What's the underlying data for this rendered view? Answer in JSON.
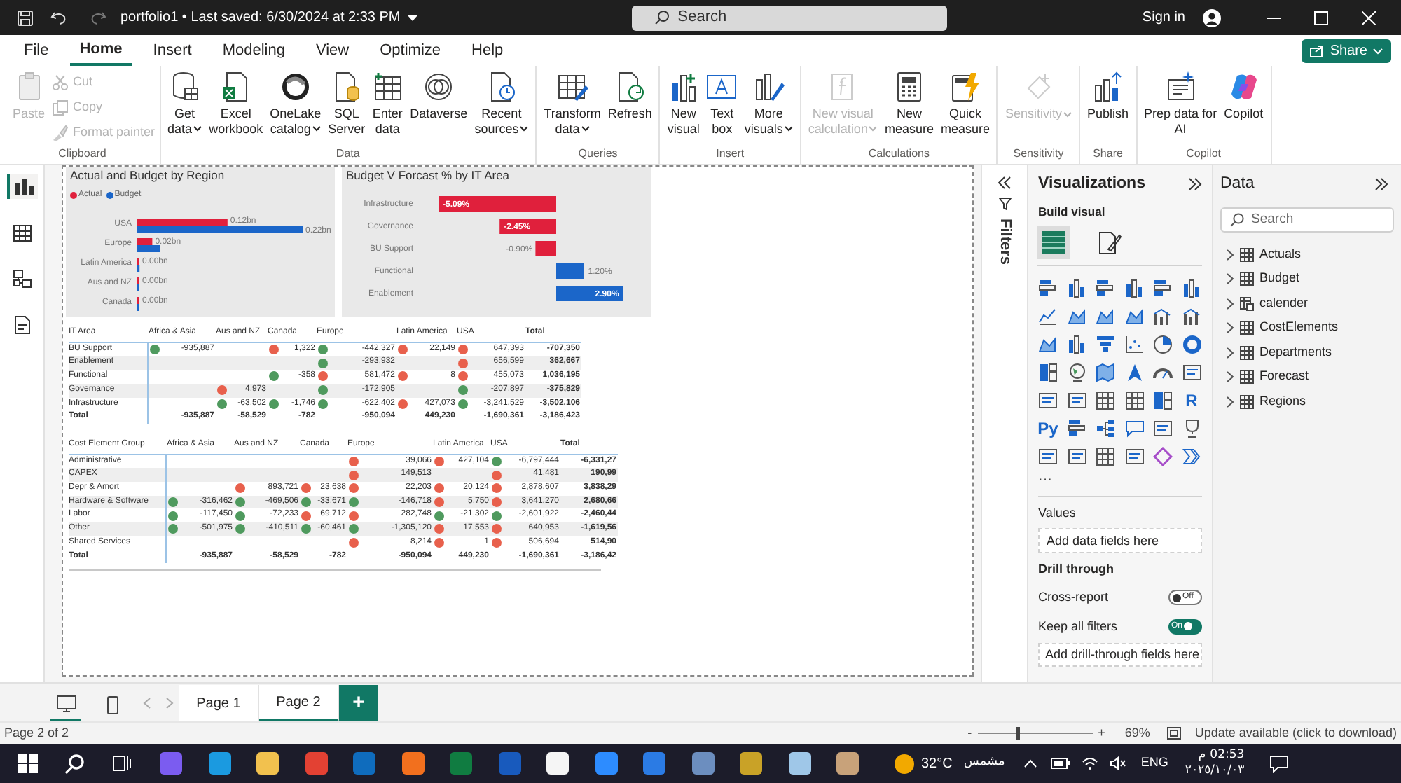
{
  "title_bar": {
    "title": "portfolio1 • Last saved: 6/30/2024 at 2:33 PM",
    "search_placeholder": "Search",
    "sign_in": "Sign in"
  },
  "menu_tabs": [
    {
      "label": "File",
      "selected": false
    },
    {
      "label": "Home",
      "selected": true
    },
    {
      "label": "Insert",
      "selected": false
    },
    {
      "label": "Modeling",
      "selected": false
    },
    {
      "label": "View",
      "selected": false
    },
    {
      "label": "Optimize",
      "selected": false
    },
    {
      "label": "Help",
      "selected": false
    }
  ],
  "share_button": "Share",
  "ribbon": [
    {
      "label": "Clipboard",
      "buttons": [
        {
          "lines": [
            "Paste"
          ],
          "kind": "large",
          "disabled": true,
          "dropdown": false
        },
        {
          "lines": [
            "Cut"
          ],
          "kind": "small",
          "disabled": true,
          "dropdown": false
        },
        {
          "lines": [
            "Copy"
          ],
          "kind": "small",
          "disabled": true,
          "dropdown": false
        },
        {
          "lines": [
            "Format painter"
          ],
          "kind": "small",
          "disabled": true,
          "dropdown": false
        }
      ]
    },
    {
      "label": "Data",
      "buttons": [
        {
          "lines": [
            "Get",
            "data"
          ],
          "kind": "large",
          "disabled": false,
          "dropdown": true
        },
        {
          "lines": [
            "Excel",
            "workbook"
          ],
          "kind": "large",
          "disabled": false,
          "dropdown": false
        },
        {
          "lines": [
            "OneLake",
            "catalog"
          ],
          "kind": "large",
          "disabled": false,
          "dropdown": true
        },
        {
          "lines": [
            "SQL",
            "Server"
          ],
          "kind": "large",
          "disabled": false,
          "dropdown": false
        },
        {
          "lines": [
            "Enter",
            "data"
          ],
          "kind": "large",
          "disabled": false,
          "dropdown": false
        },
        {
          "lines": [
            "Dataverse"
          ],
          "kind": "large",
          "disabled": false,
          "dropdown": false
        },
        {
          "lines": [
            "Recent",
            "sources"
          ],
          "kind": "large",
          "disabled": false,
          "dropdown": true
        }
      ]
    },
    {
      "label": "Queries",
      "buttons": [
        {
          "lines": [
            "Transform",
            "data"
          ],
          "kind": "large",
          "disabled": false,
          "dropdown": true
        },
        {
          "lines": [
            "Refresh"
          ],
          "kind": "large",
          "disabled": false,
          "dropdown": false
        }
      ]
    },
    {
      "label": "Insert",
      "buttons": [
        {
          "lines": [
            "New",
            "visual"
          ],
          "kind": "large",
          "disabled": false,
          "dropdown": false
        },
        {
          "lines": [
            "Text",
            "box"
          ],
          "kind": "large",
          "disabled": false,
          "dropdown": false
        },
        {
          "lines": [
            "More",
            "visuals"
          ],
          "kind": "large",
          "disabled": false,
          "dropdown": true
        }
      ]
    },
    {
      "label": "Calculations",
      "buttons": [
        {
          "lines": [
            "New visual",
            "calculation"
          ],
          "kind": "large",
          "disabled": true,
          "dropdown": true
        },
        {
          "lines": [
            "New",
            "measure"
          ],
          "kind": "large",
          "disabled": false,
          "dropdown": false
        },
        {
          "lines": [
            "Quick",
            "measure"
          ],
          "kind": "large",
          "disabled": false,
          "dropdown": false
        }
      ]
    },
    {
      "label": "Sensitivity",
      "buttons": [
        {
          "lines": [
            "Sensitivity"
          ],
          "kind": "large",
          "disabled": true,
          "dropdown": true
        }
      ]
    },
    {
      "label": "Share",
      "buttons": [
        {
          "lines": [
            "Publish"
          ],
          "kind": "large",
          "disabled": false,
          "dropdown": false
        }
      ]
    },
    {
      "label": "Copilot",
      "buttons": [
        {
          "lines": [
            "Prep data for",
            "AI"
          ],
          "kind": "large",
          "disabled": false,
          "dropdown": false
        },
        {
          "lines": [
            "Copilot"
          ],
          "kind": "large",
          "disabled": false,
          "dropdown": false
        }
      ]
    }
  ],
  "left_rail": [
    {
      "kind": "report",
      "selected": true
    },
    {
      "kind": "table",
      "selected": false
    },
    {
      "kind": "model",
      "selected": false
    },
    {
      "kind": "dax",
      "selected": false
    }
  ],
  "charts": [
    {
      "chart_data": {
        "type": "bar",
        "orientation": "horizontal",
        "title": "Actual and Budget by Region",
        "legend": "top-left",
        "categories": [
          "USA",
          "Europe",
          "Latin America",
          "Aus and NZ",
          "Canada"
        ],
        "series": [
          {
            "name": "Actual",
            "color": "#e0203c",
            "values": [
              0.12,
              0.02,
              0,
              0,
              0
            ],
            "value_labels": [
              "0.12bn",
              "0.02bn",
              "0.00bn",
              "0.00bn",
              "0.00bn"
            ]
          },
          {
            "name": "Budget",
            "color": "#1b66c9",
            "values": [
              0.22,
              0.03,
              0.003,
              0.002,
              0.001
            ],
            "value_labels": [
              "0.22bn",
              null,
              null,
              null,
              null
            ]
          }
        ]
      }
    },
    {
      "chart_data": {
        "type": "bar",
        "orientation": "horizontal",
        "stacked": true,
        "title": "Budget V Forcast % by IT Area",
        "categories": [
          "Infrastructure",
          "Governance",
          "BU Support",
          "Functional",
          "Enablement"
        ],
        "series": [
          {
            "color": "#e0203c",
            "values": [
              -5.09,
              -2.45,
              -0.9,
              null,
              null
            ],
            "value_labels": [
              "-5.09%",
              "-2.45%",
              "-0.90%",
              null,
              null
            ]
          },
          {
            "color": "#1b66c9",
            "values": [
              null,
              null,
              null,
              1.2,
              2.9
            ],
            "value_labels": [
              null,
              null,
              null,
              "1.20%",
              "2.90%"
            ]
          }
        ]
      }
    }
  ],
  "matrices": [
    {
      "row_header_title": "IT Area",
      "columns": [
        "Africa & Asia",
        "Aus and NZ",
        "Canada",
        "Europe",
        "Latin America",
        "USA",
        "Total"
      ],
      "rows": [
        {
          "kind": "row",
          "label": "BU Support",
          "cells": [
            {
              "value": "-935,887",
              "color": "#4f9a5e"
            },
            null,
            {
              "value": "1,322",
              "color": "#e8604c"
            },
            {
              "value": "-442,327",
              "color": "#4f9a5e"
            },
            {
              "value": "22,149",
              "color": "#e8604c"
            },
            {
              "value": "647,393",
              "color": "#e8604c"
            },
            {
              "value": "-707,350"
            }
          ]
        },
        {
          "kind": "row",
          "label": "Enablement",
          "cells": [
            null,
            null,
            null,
            {
              "value": "-293,932",
              "color": "#4f9a5e"
            },
            null,
            {
              "value": "656,599",
              "color": "#e8604c"
            },
            {
              "value": "362,667"
            }
          ]
        },
        {
          "kind": "row",
          "label": "Functional",
          "cells": [
            null,
            null,
            {
              "value": "-358",
              "color": "#4f9a5e"
            },
            {
              "value": "581,472",
              "color": "#e8604c"
            },
            {
              "value": "8",
              "color": "#e8604c"
            },
            {
              "value": "455,073",
              "color": "#e8604c"
            },
            {
              "value": "1,036,195"
            }
          ]
        },
        {
          "kind": "row",
          "label": "Governance",
          "cells": [
            null,
            {
              "value": "4,973",
              "color": "#e8604c"
            },
            null,
            {
              "value": "-172,905",
              "color": "#4f9a5e"
            },
            null,
            {
              "value": "-207,897",
              "color": "#4f9a5e"
            },
            {
              "value": "-375,829"
            }
          ]
        },
        {
          "kind": "row",
          "label": "Infrastructure",
          "cells": [
            null,
            {
              "value": "-63,502",
              "color": "#4f9a5e"
            },
            {
              "value": "-1,746",
              "color": "#4f9a5e"
            },
            {
              "value": "-622,402",
              "color": "#4f9a5e"
            },
            {
              "value": "427,073",
              "color": "#e8604c"
            },
            {
              "value": "-3,241,529",
              "color": "#4f9a5e"
            },
            {
              "value": "-3,502,106"
            }
          ]
        },
        {
          "kind": "total",
          "label": "Total",
          "cells": [
            {
              "value": "-935,887"
            },
            {
              "value": "-58,529"
            },
            {
              "value": "-782"
            },
            {
              "value": "-950,094"
            },
            {
              "value": "449,230"
            },
            {
              "value": "-1,690,361"
            },
            {
              "value": "-3,186,423"
            }
          ]
        }
      ]
    },
    {
      "row_header_title": "Cost Element Group",
      "columns": [
        "Africa & Asia",
        "Aus and NZ",
        "Canada",
        "Europe",
        "Latin America",
        "USA",
        "Total"
      ],
      "rows": [
        {
          "kind": "row",
          "label": "Administrative",
          "cells": [
            null,
            null,
            null,
            {
              "value": "39,066",
              "color": "#e8604c"
            },
            {
              "value": "427,104",
              "color": "#e8604c"
            },
            {
              "value": "-6,797,444",
              "color": "#4f9a5e"
            },
            {
              "value": "-6,331,27"
            }
          ]
        },
        {
          "kind": "row",
          "label": "CAPEX",
          "cells": [
            null,
            null,
            null,
            {
              "value": "149,513",
              "color": "#e8604c"
            },
            null,
            {
              "value": "41,481",
              "color": "#e8604c"
            },
            {
              "value": "190,99"
            }
          ]
        },
        {
          "kind": "row",
          "label": "Depr & Amort",
          "cells": [
            null,
            {
              "value": "893,721",
              "color": "#e8604c"
            },
            {
              "value": "23,638",
              "color": "#e8604c"
            },
            {
              "value": "22,203",
              "color": "#e8604c"
            },
            {
              "value": "20,124",
              "color": "#e8604c"
            },
            {
              "value": "2,878,607",
              "color": "#e8604c"
            },
            {
              "value": "3,838,29"
            }
          ]
        },
        {
          "kind": "row",
          "label": "Hardware & Software",
          "cells": [
            {
              "value": "-316,462",
              "color": "#4f9a5e"
            },
            {
              "value": "-469,506",
              "color": "#4f9a5e"
            },
            {
              "value": "-33,671",
              "color": "#4f9a5e"
            },
            {
              "value": "-146,718",
              "color": "#4f9a5e"
            },
            {
              "value": "5,750",
              "color": "#e8604c"
            },
            {
              "value": "3,641,270",
              "color": "#e8604c"
            },
            {
              "value": "2,680,66"
            }
          ]
        },
        {
          "kind": "row",
          "label": "Labor",
          "cells": [
            {
              "value": "-117,450",
              "color": "#4f9a5e"
            },
            {
              "value": "-72,233",
              "color": "#4f9a5e"
            },
            {
              "value": "69,712",
              "color": "#e8604c"
            },
            {
              "value": "282,748",
              "color": "#e8604c"
            },
            {
              "value": "-21,302",
              "color": "#4f9a5e"
            },
            {
              "value": "-2,601,922",
              "color": "#4f9a5e"
            },
            {
              "value": "-2,460,44"
            }
          ]
        },
        {
          "kind": "row",
          "label": "Other",
          "cells": [
            {
              "value": "-501,975",
              "color": "#4f9a5e"
            },
            {
              "value": "-410,511",
              "color": "#4f9a5e"
            },
            {
              "value": "-60,461",
              "color": "#4f9a5e"
            },
            {
              "value": "-1,305,120",
              "color": "#4f9a5e"
            },
            {
              "value": "17,553",
              "color": "#e8604c"
            },
            {
              "value": "640,953",
              "color": "#e8604c"
            },
            {
              "value": "-1,619,56"
            }
          ]
        },
        {
          "kind": "row",
          "label": "Shared Services",
          "cells": [
            null,
            null,
            null,
            {
              "value": "8,214",
              "color": "#e8604c"
            },
            {
              "value": "1",
              "color": "#e8604c"
            },
            {
              "value": "506,694",
              "color": "#e8604c"
            },
            {
              "value": "514,90"
            }
          ]
        },
        {
          "kind": "total",
          "label": "Total",
          "cells": [
            {
              "value": "-935,887"
            },
            {
              "value": "-58,529"
            },
            {
              "value": "-782"
            },
            {
              "value": "-950,094"
            },
            {
              "value": "449,230"
            },
            {
              "value": "-1,690,361"
            },
            {
              "value": "-3,186,42"
            }
          ]
        }
      ]
    }
  ],
  "filters_pane": {
    "label": "Filters"
  },
  "visualizations": {
    "title": "Visualizations",
    "build_visual": "Build visual",
    "modes": [
      {
        "kind": "fields",
        "selected": true
      },
      {
        "kind": "format",
        "selected": false
      }
    ],
    "gallery": [
      {
        "kind": "hbars"
      },
      {
        "kind": "cols"
      },
      {
        "kind": "hbars"
      },
      {
        "kind": "cols"
      },
      {
        "kind": "hbars"
      },
      {
        "kind": "cols"
      },
      {
        "kind": "line"
      },
      {
        "kind": "area"
      },
      {
        "kind": "area"
      },
      {
        "kind": "area"
      },
      {
        "kind": "combo"
      },
      {
        "kind": "combo"
      },
      {
        "kind": "area"
      },
      {
        "kind": "cols"
      },
      {
        "kind": "funnel"
      },
      {
        "kind": "scatter"
      },
      {
        "kind": "pie"
      },
      {
        "kind": "donut"
      },
      {
        "kind": "grid"
      },
      {
        "kind": "globe"
      },
      {
        "kind": "map"
      },
      {
        "kind": "arrow"
      },
      {
        "kind": "gauge"
      },
      {
        "kind": "card"
      },
      {
        "kind": "card"
      },
      {
        "kind": "card"
      },
      {
        "kind": "table"
      },
      {
        "kind": "table"
      },
      {
        "kind": "grid"
      },
      {
        "kind": "text",
        "label": "R"
      },
      {
        "kind": "text",
        "label": "Py"
      },
      {
        "kind": "hbars"
      },
      {
        "kind": "tree"
      },
      {
        "kind": "bubble"
      },
      {
        "kind": "card"
      },
      {
        "kind": "trophy"
      },
      {
        "kind": "card"
      },
      {
        "kind": "card"
      },
      {
        "kind": "table"
      },
      {
        "kind": "card"
      },
      {
        "kind": "diamond"
      },
      {
        "kind": "chevron"
      }
    ],
    "more": "···",
    "values_label": "Values",
    "values_placeholder": "Add data fields here",
    "drill_through": "Drill through",
    "toggles": [
      {
        "label": "Cross-report",
        "on": false,
        "text": "Off"
      },
      {
        "label": "Keep all filters",
        "on": true,
        "text": "On"
      }
    ],
    "drill_placeholder": "Add drill-through fields here"
  },
  "data_pane": {
    "title": "Data",
    "search_placeholder": "Search",
    "tables": [
      {
        "name": "Actuals",
        "kind": "table",
        "expanded": false
      },
      {
        "name": "Budget",
        "kind": "table",
        "expanded": false
      },
      {
        "name": "calender",
        "kind": "calendar",
        "expanded": false
      },
      {
        "name": "CostElements",
        "kind": "table",
        "expanded": false
      },
      {
        "name": "Departments",
        "kind": "table",
        "expanded": false
      },
      {
        "name": "Forecast",
        "kind": "table",
        "expanded": false
      },
      {
        "name": "Regions",
        "kind": "table",
        "expanded": false
      }
    ]
  },
  "layouts": [
    {
      "kind": "desktop",
      "selected": true
    },
    {
      "kind": "mobile",
      "selected": false
    }
  ],
  "page_tabs": [
    {
      "label": "Page 1",
      "selected": false
    },
    {
      "label": "Page 2",
      "selected": true
    }
  ],
  "add_page": "+",
  "status_bar": {
    "page": "Page 2 of 2",
    "zoom_minus": "-",
    "zoom_plus": "+",
    "zoom": {
      "level": 0.35
    },
    "zoom_text": "69%",
    "update": "Update available (click to download)"
  },
  "taskbar": {
    "apps": [
      {
        "kind": "copilot"
      },
      {
        "kind": "edge"
      },
      {
        "kind": "folder"
      },
      {
        "kind": "chrome"
      },
      {
        "kind": "outlook"
      },
      {
        "kind": "firefox"
      },
      {
        "kind": "excel"
      },
      {
        "kind": "word"
      },
      {
        "kind": "file"
      },
      {
        "kind": "zoom"
      },
      {
        "kind": "globe"
      },
      {
        "kind": "remote"
      },
      {
        "kind": "photo"
      },
      {
        "kind": "snow"
      },
      {
        "kind": "paint"
      }
    ],
    "weather_temp": "32°C",
    "weather_text": "مشمس",
    "language": "ENG",
    "time": "02:53",
    "meridiem": "م",
    "date": "٢٠٢٥/١٠/٠٣"
  }
}
